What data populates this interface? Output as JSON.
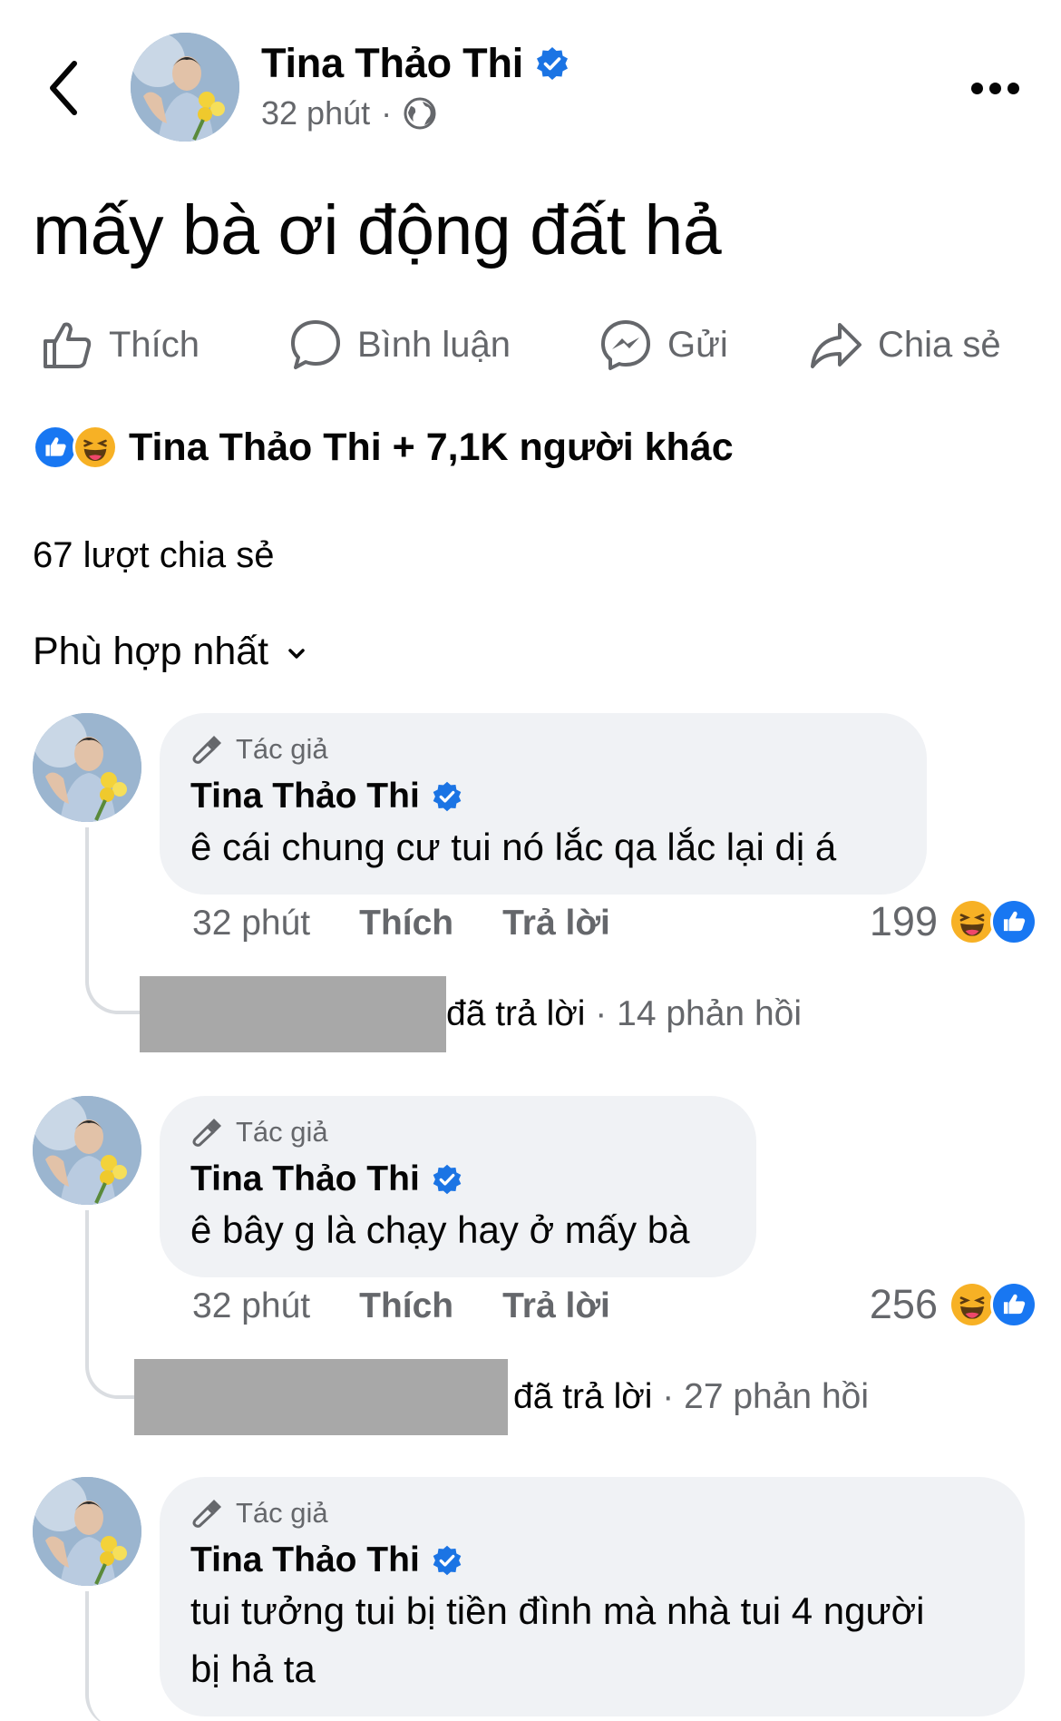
{
  "header": {
    "author": "Tina Thảo Thi",
    "time": "32 phút",
    "separator": "·",
    "icons": {
      "back": "chevron-left-icon",
      "privacy": "globe-icon",
      "more": "more-horizontal-icon",
      "verified": "verified-badge-icon"
    }
  },
  "post": {
    "text": "mấy bà ơi động đất hả"
  },
  "actions": [
    {
      "label": "Thích",
      "icon": "thumbs-up-icon"
    },
    {
      "label": "Bình luận",
      "icon": "comment-icon"
    },
    {
      "label": "Gửi",
      "icon": "messenger-icon"
    },
    {
      "label": "Chia sẻ",
      "icon": "share-icon"
    }
  ],
  "reactions": {
    "text": "Tina Thảo Thi + 7,1K người khác",
    "icons": [
      "like-reaction-icon",
      "haha-reaction-icon"
    ]
  },
  "shares": "67 lượt chia sẻ",
  "sort": {
    "label": "Phù hợp nhất",
    "icon": "chevron-down-icon"
  },
  "comments": [
    {
      "badge": "Tác giả",
      "name": "Tina Thảo Thi",
      "text_lines": [
        "ê cái chung cư tui nó lắc qa lắc lại dị á"
      ],
      "time": "32 phút",
      "like": "Thích",
      "reply": "Trả lời",
      "reaction_count": "199",
      "replies": {
        "who": "đã trả lời",
        "sep": " · ",
        "count": "14 phản hồi"
      }
    },
    {
      "badge": "Tác giả",
      "name": "Tina Thảo Thi",
      "text_lines": [
        "ê bây g là chạy hay ở mấy bà"
      ],
      "time": "32 phút",
      "like": "Thích",
      "reply": "Trả lời",
      "reaction_count": "256",
      "replies": {
        "who": "đã trả lời",
        "sep": " · ",
        "count": "27 phản hồi"
      }
    },
    {
      "badge": "Tác giả",
      "name": "Tina Thảo Thi",
      "text_lines": [
        "tui tưởng tui bị tiền đình mà nhà tui 4 người",
        "bị hả ta"
      ]
    }
  ],
  "colors": {
    "verified": "#1b74e4",
    "like": "#1877f2",
    "bubble": "#f0f2f5",
    "secondary_text": "#65676b",
    "redaction": "#a8a8a8"
  }
}
